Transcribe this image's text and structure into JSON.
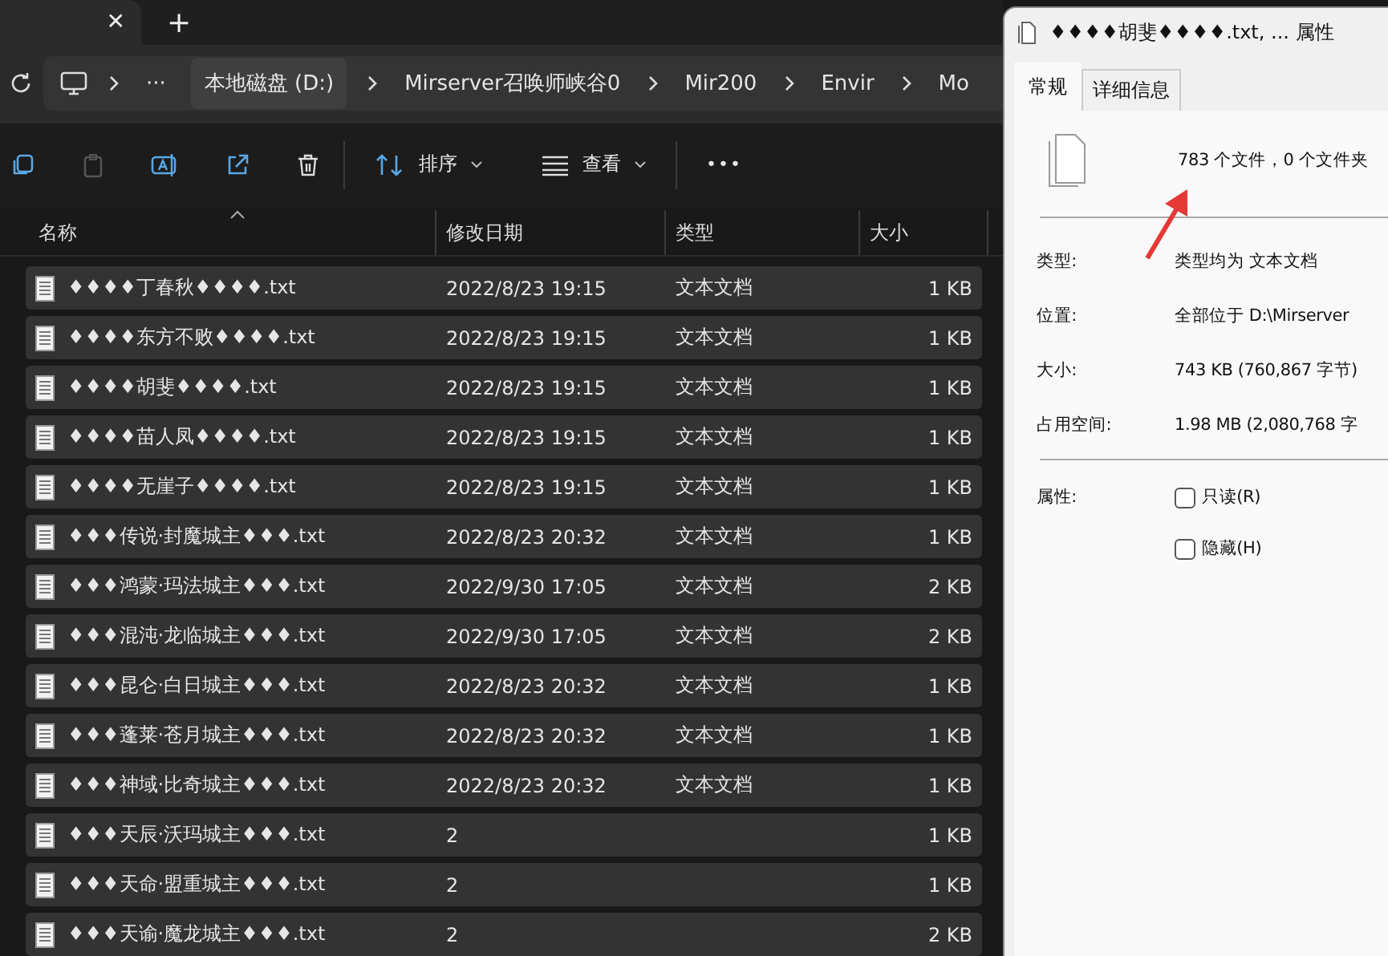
{
  "tabs": {
    "close": "✕",
    "new": "+"
  },
  "address_bar": {
    "more": "···",
    "crumbs": [
      {
        "label": "本地磁盘 (D:)",
        "selected": true
      },
      {
        "label": "Mirserver召唤师峡谷0",
        "selected": false
      },
      {
        "label": "Mir200",
        "selected": false
      },
      {
        "label": "Envir",
        "selected": false
      },
      {
        "label": "Mo",
        "selected": false
      }
    ]
  },
  "toolbar": {
    "sort": "排序",
    "view": "查看",
    "more": "•••"
  },
  "table": {
    "columns": [
      "名称",
      "修改日期",
      "类型",
      "大小"
    ],
    "rows": [
      {
        "name": "♦♦♦♦丁春秋♦♦♦♦.txt",
        "date": "2022/8/23 19:15",
        "type": "文本文档",
        "size": "1 KB",
        "selected": true
      },
      {
        "name": "♦♦♦♦东方不败♦♦♦♦.txt",
        "date": "2022/8/23 19:15",
        "type": "文本文档",
        "size": "1 KB",
        "selected": true
      },
      {
        "name": "♦♦♦♦胡斐♦♦♦♦.txt",
        "date": "2022/8/23 19:15",
        "type": "文本文档",
        "size": "1 KB",
        "selected": true
      },
      {
        "name": "♦♦♦♦苗人凤♦♦♦♦.txt",
        "date": "2022/8/23 19:15",
        "type": "文本文档",
        "size": "1 KB",
        "selected": true
      },
      {
        "name": "♦♦♦♦无崖子♦♦♦♦.txt",
        "date": "2022/8/23 19:15",
        "type": "文本文档",
        "size": "1 KB",
        "selected": true
      },
      {
        "name": "♦♦♦传说·封魔城主♦♦♦.txt",
        "date": "2022/8/23 20:32",
        "type": "文本文档",
        "size": "1 KB",
        "selected": true
      },
      {
        "name": "♦♦♦鸿蒙·玛法城主♦♦♦.txt",
        "date": "2022/9/30 17:05",
        "type": "文本文档",
        "size": "2 KB",
        "selected": true
      },
      {
        "name": "♦♦♦混沌·龙临城主♦♦♦.txt",
        "date": "2022/9/30 17:05",
        "type": "文本文档",
        "size": "2 KB",
        "selected": true
      },
      {
        "name": "♦♦♦昆仑·白日城主♦♦♦.txt",
        "date": "2022/8/23 20:32",
        "type": "文本文档",
        "size": "1 KB",
        "selected": true
      },
      {
        "name": "♦♦♦蓬莱·苍月城主♦♦♦.txt",
        "date": "2022/8/23 20:32",
        "type": "文本文档",
        "size": "1 KB",
        "selected": true
      },
      {
        "name": "♦♦♦神域·比奇城主♦♦♦.txt",
        "date": "2022/8/23 20:32",
        "type": "文本文档",
        "size": "1 KB",
        "selected": true
      },
      {
        "name": "♦♦♦天辰·沃玛城主♦♦♦.txt",
        "date": "2",
        "size": "1 KB",
        "selected": true
      },
      {
        "name": "♦♦♦天命·盟重城主♦♦♦.txt",
        "date": "2",
        "size": "1 KB",
        "selected": true
      },
      {
        "name": "♦♦♦天谕·魔龙城主♦♦♦.txt",
        "date": "2",
        "size": "2 KB",
        "selected": true
      }
    ]
  },
  "dialog": {
    "title": "♦♦♦♦胡斐♦♦♦♦.txt, ... 属性",
    "tabs": [
      {
        "label": "常规",
        "selected": true
      },
      {
        "label": "详细信息",
        "selected": false
      }
    ],
    "summary": "783 个文件，0 个文件夹",
    "fields": [
      {
        "label": "类型:",
        "value": "类型均为 文本文档"
      },
      {
        "label": "位置:",
        "value": "全部位于 D:\\Mirserver"
      },
      {
        "label": "大小:",
        "value": "743 KB (760,867 字节)"
      },
      {
        "label": "占用空间:",
        "value": "1.98 MB (2,080,768 字"
      }
    ],
    "attributes_label": "属性:",
    "attributes": [
      {
        "label": "只读(R)",
        "checked": false
      },
      {
        "label": "隐藏(H)",
        "checked": false
      }
    ]
  }
}
